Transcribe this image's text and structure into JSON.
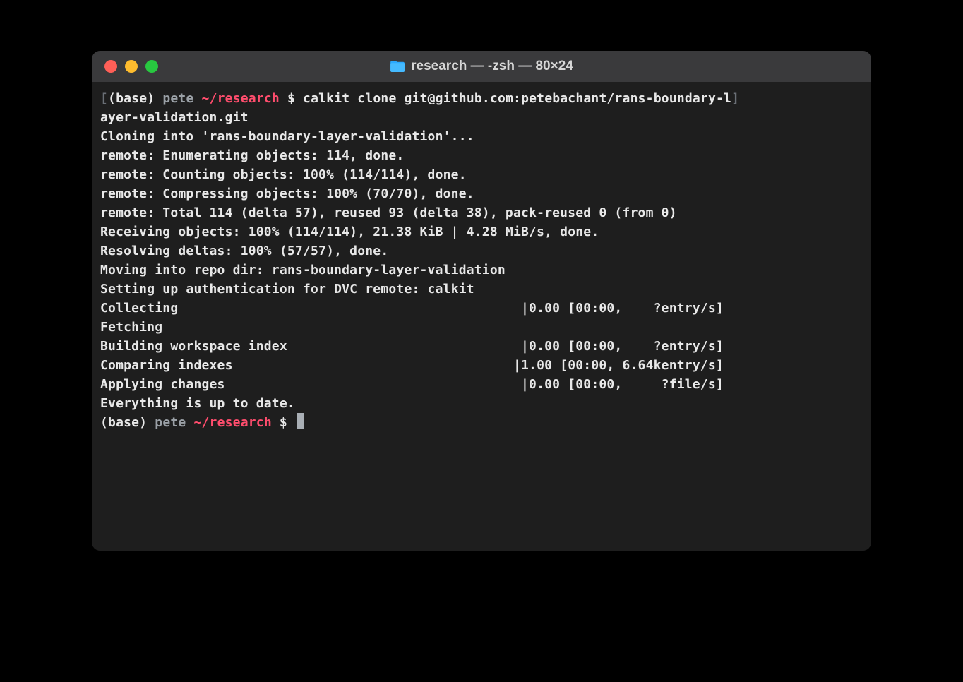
{
  "window": {
    "title": "research — -zsh — 80×24"
  },
  "prompt1": {
    "open_bracket": "[",
    "env": "(base)",
    "user": "pete",
    "path": "~/research",
    "sym": "$",
    "cmd": "calkit clone git@github.com:petebachant/rans-boundary-l",
    "close_bracket": "]"
  },
  "cmd_wrap": "ayer-validation.git",
  "output": [
    "Cloning into 'rans-boundary-layer-validation'...",
    "remote: Enumerating objects: 114, done.",
    "remote: Counting objects: 100% (114/114), done.",
    "remote: Compressing objects: 100% (70/70), done.",
    "remote: Total 114 (delta 57), reused 93 (delta 38), pack-reused 0 (from 0)",
    "Receiving objects: 100% (114/114), 21.38 KiB | 4.28 MiB/s, done.",
    "Resolving deltas: 100% (57/57), done.",
    "Moving into repo dir: rans-boundary-layer-validation",
    "Setting up authentication for DVC remote: calkit"
  ],
  "progress_rows": [
    {
      "label": "Collecting",
      "stats": "|0.00 [00:00,    ?entry/s]"
    },
    {
      "label": "Fetching",
      "stats": ""
    },
    {
      "label": "Building workspace index",
      "stats": "|0.00 [00:00,    ?entry/s]"
    },
    {
      "label": "Comparing indexes",
      "stats": "|1.00 [00:00, 6.64kentry/s]"
    },
    {
      "label": "Applying changes",
      "stats": "|0.00 [00:00,     ?file/s]"
    }
  ],
  "final_line": "Everything is up to date.",
  "prompt2": {
    "env": "(base)",
    "user": "pete",
    "path": "~/research",
    "sym": "$"
  },
  "colors": {
    "titlebar": "#3a3a3c",
    "body_bg": "#1e1e1e",
    "text": "#e8e8e8",
    "user": "#9aa0a6",
    "path": "#ff4d6d",
    "bracket": "#6a6f76",
    "traffic_red": "#ff5f57",
    "traffic_yellow": "#febc2e",
    "traffic_green": "#28c840",
    "folder": "#2aa9ff"
  }
}
